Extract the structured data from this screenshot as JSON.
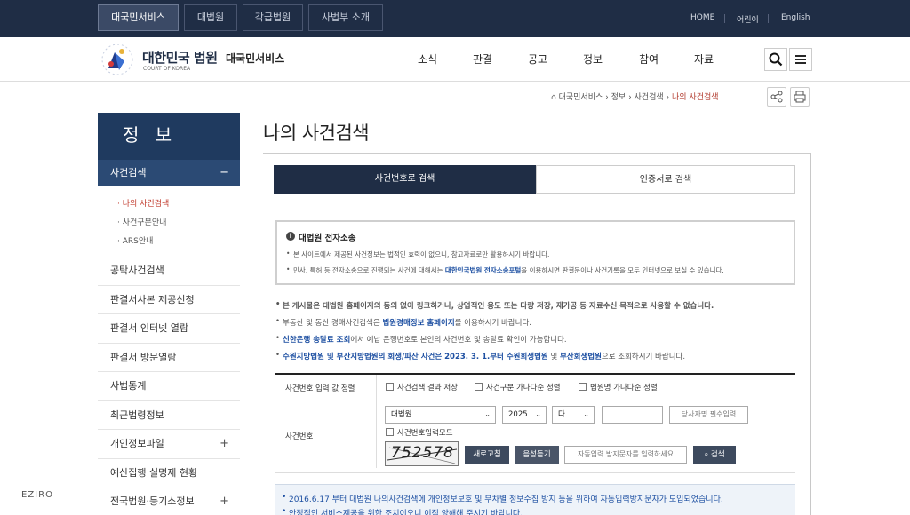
{
  "topbar": {
    "tabs": [
      "대국민서비스",
      "대법원",
      "각급법원",
      "사법부 소개"
    ],
    "links": [
      "HOME",
      "어린이",
      "English"
    ]
  },
  "header": {
    "brand": "대한민국 법원",
    "brand_sub": "COURT OF KOREA",
    "service": "대국민서비스",
    "nav": [
      "소식",
      "판결",
      "공고",
      "정보",
      "참여",
      "자료"
    ]
  },
  "breadcrumb": {
    "items": [
      "대국민서비스",
      "정보",
      "사건검색"
    ],
    "current": "나의 사건검색"
  },
  "sidebar": {
    "title": "정 보",
    "active": "사건검색",
    "active_icon": "−",
    "subitems": [
      "· 나의 사건검색",
      "· 사건구분안내",
      "· ARS안내"
    ],
    "items": [
      {
        "label": "공탁사건검색",
        "plus": ""
      },
      {
        "label": "판결서사본 제공신청",
        "plus": ""
      },
      {
        "label": "판결서 인터넷 열람",
        "plus": ""
      },
      {
        "label": "판결서 방문열람",
        "plus": ""
      },
      {
        "label": "사법통계",
        "plus": ""
      },
      {
        "label": "최근법령정보",
        "plus": ""
      },
      {
        "label": "개인정보파일",
        "plus": "+"
      },
      {
        "label": "예산집행 실명제 현황",
        "plus": ""
      },
      {
        "label": "전국법원·등기소정보",
        "plus": "+"
      }
    ]
  },
  "page": {
    "title": "나의 사건검색"
  },
  "tabs": {
    "first": "사건번호로 검색",
    "second": "인증서로 검색"
  },
  "notice": {
    "title": "대법원 전자소송",
    "info_icon": "i",
    "line1": "본 사이트에서 제공된 사건정보는 법적인 효력이 없으니, 참고자료로만 활용하시기 바랍니다.",
    "line2_a": "민사, 특허 등 전자소송으로 진행되는 사건에 대해서는 ",
    "line2_link": "대한민국법원 전자소송포털",
    "line2_b": "을 이용하시면 판결문이나 사건기록을 모두 인터넷으로 보실 수 있습니다."
  },
  "bullets": {
    "b1": "본 게시물은 대법원 홈페이지의 동의 없이 링크하거나, 상업적인 용도 또는 다량 저장, 재가공 등 자료수신 목적으로 사용할 수 없습니다.",
    "b2_a": "부동산 및 동산 경매사건검색은 ",
    "b2_link": "법원경매정보 홈페이지",
    "b2_b": "를 이용하시기 바랍니다.",
    "b3_link": "신한은행 송달료 조회",
    "b3_b": "에서 예납 은행번호로 본인의 사건번호 및 송달료 확인이 가능합니다.",
    "b4_a": "수원지방법원 및 부산지방법원의 회생/파산 사건은 2023. 3. 1.부터 ",
    "b4_link1": "수원회생법원",
    "b4_mid": " 및 ",
    "b4_link2": "부산회생법원",
    "b4_b": "으로 조회하시기 바랍니다."
  },
  "form": {
    "sort_label": "사건번호 입력 값 정렬",
    "checks": [
      "사건검색 결과 저장",
      "사건구분 가나다순 정렬",
      "법원명 가나다순 정렬"
    ],
    "number_label": "사건번호",
    "court": "대법원",
    "year": "2025",
    "type": "다",
    "party_placeholder": "당사자명 필수입력",
    "input_mode": "사건번호입력모드",
    "captcha": "752578",
    "refresh": "새로고침",
    "audio": "음성듣기",
    "captcha_placeholder": "자동입력 방지문자를 입력하세요",
    "search": "검색"
  },
  "bottom": {
    "line1": "2016.6.17 부터 대법원 나의사건검색에 개인정보보호 및 무차별 정보수집 방지 등을 위하여 자동입력방지문자가 도입되었습니다.",
    "line2": "안정적인 서비스제공을 위한 조치이오니 이점 양해해 주시기 바랍니다."
  },
  "watermark": "EZIRO"
}
